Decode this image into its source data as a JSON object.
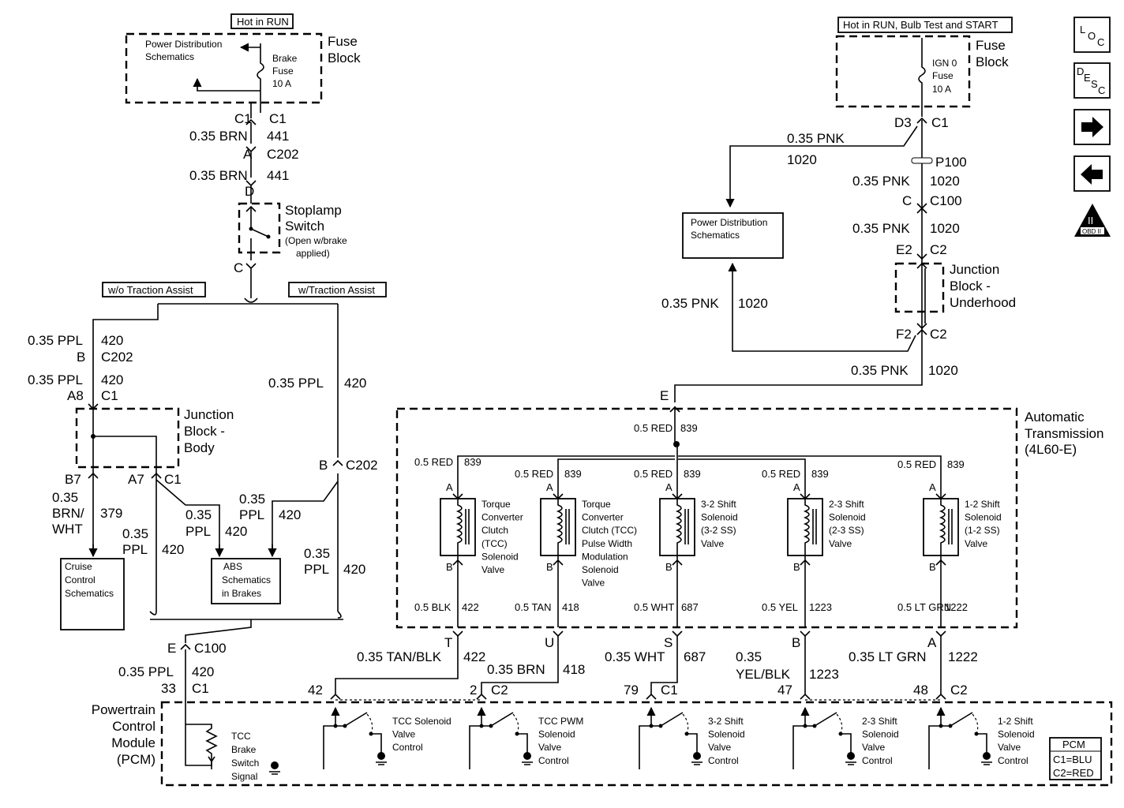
{
  "nav_icons": {
    "loc": "LOC",
    "desc": "DESC",
    "next": "arrow-right",
    "prev": "arrow-left",
    "obd": "OBD II",
    "obd_num": "II"
  },
  "left": {
    "hot_run": "Hot in RUN",
    "fuse_block_1": "Fuse",
    "fuse_block_2": "Block",
    "pds_1": "Power Distribution",
    "pds_2": "Schematics",
    "brake_fuse_1": "Brake",
    "brake_fuse_2": "Fuse",
    "brake_fuse_3": "10 A",
    "c1a": "C1",
    "c1b": "C1",
    "w1": "0.35 BRN",
    "c1": "441",
    "a": "A",
    "c202": "C202",
    "w2": "0.35 BRN",
    "c2": "441",
    "d": "D",
    "stop_1": "Stoplamp",
    "stop_2": "Switch",
    "stop_3": "(Open w/brake",
    "stop_4": "applied)",
    "c": "C",
    "wo_ta": "w/o Traction Assist",
    "w_ta": "w/Traction Assist",
    "w3": "0.35 PPL",
    "c3": "420",
    "b": "B",
    "c202b": "C202",
    "w4": "0.35 PPL",
    "c4": "420",
    "a8": "A8",
    "c1c": "C1",
    "jb_1": "Junction",
    "jb_2": "Block -",
    "jb_3": "Body",
    "b7": "B7",
    "a7": "A7",
    "c1d": "C1",
    "w5_1": "0.35",
    "w5_2": "BRN/",
    "w5_3": "WHT",
    "c5": "379",
    "w6_1": "0.35",
    "w6_2": "PPL",
    "c6": "420",
    "w7_1": "0.35",
    "w7_2": "PPL",
    "c7": "420",
    "cruise_1": "Cruise",
    "cruise_2": "Control",
    "cruise_3": "Schematics",
    "abs_1": "ABS",
    "abs_2": "Schematics",
    "abs_3": "in Brakes",
    "w8": "0.35 PPL",
    "c8": "420",
    "b2": "B",
    "c202c": "C202",
    "w9_1": "0.35",
    "w9_2": "PPL",
    "c9": "420",
    "w10_1": "0.35",
    "w10_2": "PPL",
    "c10": "420",
    "e": "E",
    "c100": "C100",
    "w11": "0.35 PPL",
    "c11": "420",
    "p33": "33",
    "c1e": "C1"
  },
  "right": {
    "hot": "Hot in RUN, Bulb Test and START",
    "fuse_block_1": "Fuse",
    "fuse_block_2": "Block",
    "ign_1": "IGN 0",
    "ign_2": "Fuse",
    "ign_3": "10 A",
    "d3": "D3",
    "c1": "C1",
    "w1": "0.35 PNK",
    "c1n": "1020",
    "p100": "P100",
    "w2": "0.35 PNK",
    "c2": "1020",
    "c": "C",
    "c100": "C100",
    "w3": "0.35 PNK",
    "c3": "1020",
    "e2": "E2",
    "c2b": "C2",
    "jb_1": "Junction",
    "jb_2": "Block -",
    "jb_3": "Underhood",
    "pds_1": "Power Distribution",
    "pds_2": "Schematics",
    "w4": "0.35 PNK",
    "c4": "1020",
    "f2": "F2",
    "c2c": "C2",
    "w5": "0.35 PNK",
    "c5": "1020",
    "e": "E"
  },
  "transmission": {
    "title_1": "Automatic",
    "title_2": "Transmission",
    "title_3": "(4L60-E)",
    "feed_wire": "0.5 RED",
    "feed_circuit": "839",
    "solenoids": [
      {
        "in_wire": "0.5 RED",
        "in_circ": "839",
        "pin_a": "A",
        "pin_b": "B",
        "name": [
          "Torque",
          "Converter",
          "Clutch",
          "(TCC)",
          "Solenoid",
          "Valve"
        ],
        "out_wire": "0.5 BLK",
        "out_circ": "422",
        "conn": "T",
        "harness_wire": "0.35 TAN/BLK",
        "harness_circ": "422",
        "pcm_pin": "42",
        "pcm_conn": "",
        "pcm_name": [
          "TCC Solenoid",
          "Valve",
          "Control"
        ]
      },
      {
        "in_wire": "0.5 RED",
        "in_circ": "839",
        "pin_a": "A",
        "pin_b": "B",
        "name": [
          "Torque",
          "Converter",
          "Clutch (TCC)",
          "Pulse Width",
          "Modulation",
          "Solenoid",
          "Valve"
        ],
        "out_wire": "0.5 TAN",
        "out_circ": "418",
        "conn": "U",
        "harness_wire": "0.35 BRN",
        "harness_circ": "418",
        "pcm_pin": "2",
        "pcm_conn": "C2",
        "pcm_name": [
          "TCC PWM",
          "Solenoid",
          "Valve",
          "Control"
        ]
      },
      {
        "in_wire": "0.5 RED",
        "in_circ": "839",
        "pin_a": "A",
        "pin_b": "B",
        "name": [
          "3-2 Shift",
          "Solenoid",
          "(3-2 SS)",
          "Valve"
        ],
        "out_wire": "0.5 WHT",
        "out_circ": "687",
        "conn": "S",
        "harness_wire": "0.35 WHT",
        "harness_circ": "687",
        "pcm_pin": "79",
        "pcm_conn": "C1",
        "pcm_name": [
          "3-2 Shift",
          "Solenoid",
          "Valve",
          "Control"
        ]
      },
      {
        "in_wire": "0.5 RED",
        "in_circ": "839",
        "pin_a": "A",
        "pin_b": "B",
        "name": [
          "2-3 Shift",
          "Solenoid",
          "(2-3 SS)",
          "Valve"
        ],
        "out_wire": "0.5 YEL",
        "out_circ": "1223",
        "conn": "B",
        "harness_wire": "0.35 YEL/BLK",
        "harness_circ": "1223",
        "pcm_pin": "47",
        "pcm_conn": "",
        "pcm_name": [
          "2-3 Shift",
          "Solenoid",
          "Valve",
          "Control"
        ]
      },
      {
        "in_wire": "0.5 RED",
        "in_circ": "839",
        "pin_a": "A",
        "pin_b": "B",
        "name": [
          "1-2 Shift",
          "Solenoid",
          "(1-2 SS)",
          "Valve"
        ],
        "out_wire": "0.5 LT GRN",
        "out_circ": "1222",
        "conn": "A",
        "harness_wire": "0.35 LT GRN",
        "harness_circ": "1222",
        "pcm_pin": "48",
        "pcm_conn": "C2",
        "pcm_name": [
          "1-2 Shift",
          "Solenoid",
          "Valve",
          "Control"
        ]
      }
    ]
  },
  "pcm": {
    "title": [
      "Powertrain",
      "Control",
      "Module",
      "(PCM)"
    ],
    "brake_signal": [
      "TCC",
      "Brake",
      "Switch",
      "Signal"
    ],
    "legend_title": "PCM",
    "legend_c1": "C1=BLU",
    "legend_c2": "C2=RED"
  }
}
